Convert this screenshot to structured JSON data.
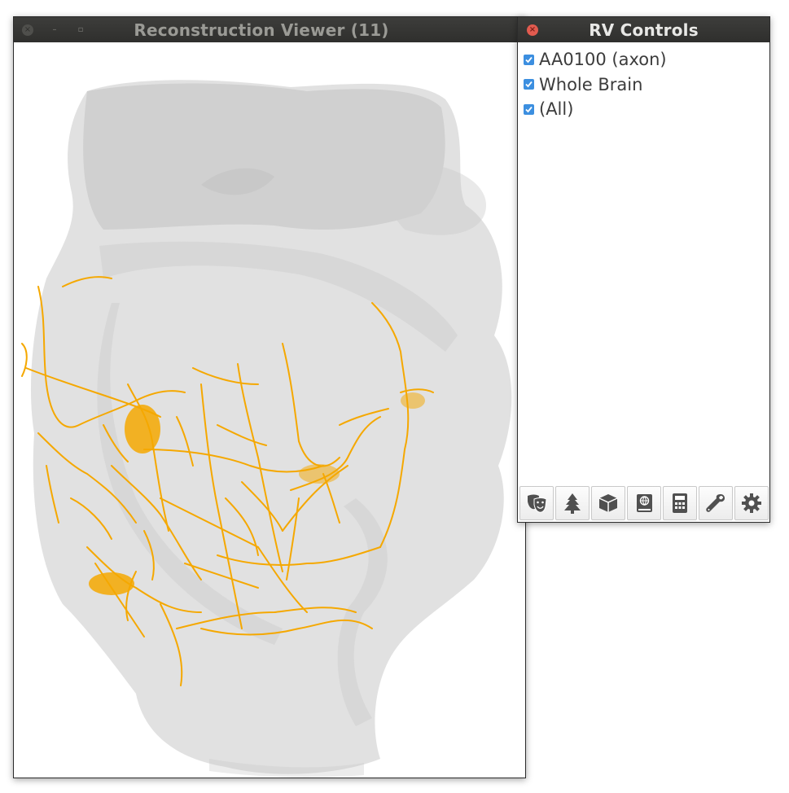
{
  "viewer_window": {
    "title": "Reconstruction Viewer (11)",
    "close_glyph": "×",
    "minimize_glyph": "–",
    "maximize_glyph": "▫"
  },
  "controls_window": {
    "title": "RV Controls",
    "close_glyph": "×",
    "items": [
      {
        "label": "AA0100 (axon)",
        "checked": true
      },
      {
        "label": "Whole Brain",
        "checked": true
      },
      {
        "label": "(All)",
        "checked": true
      }
    ],
    "toolbar_icons": [
      "theater-masks-icon",
      "tree-icon",
      "cube-icon",
      "atlas-icon",
      "calculator-icon",
      "wrench-icon",
      "gear-icon"
    ]
  },
  "colors": {
    "axon": "#f5a800",
    "brain_mesh": "#d8d8d8",
    "checkbox": "#3c8fe0",
    "titlebar": "#333331",
    "icon": "#505050"
  }
}
